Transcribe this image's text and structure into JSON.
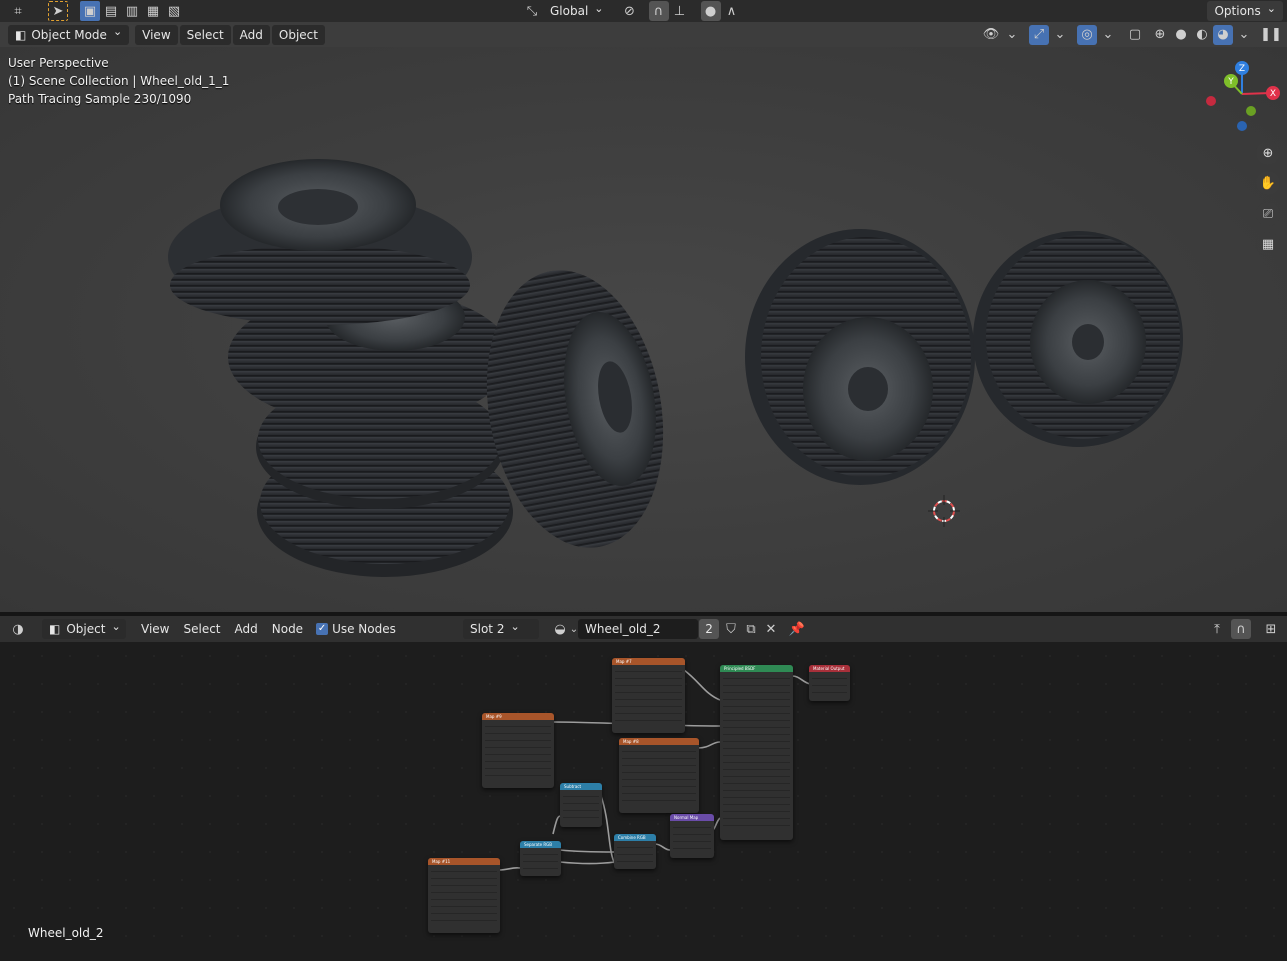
{
  "top_header": {
    "orientation": "Global",
    "options_label": "Options"
  },
  "viewport_header": {
    "mode": "Object Mode",
    "menus": [
      "View",
      "Select",
      "Add",
      "Object"
    ]
  },
  "viewport_overlay": {
    "perspective": "User Perspective",
    "collection": "(1) Scene Collection | Wheel_old_1_1",
    "render_status": "Path Tracing Sample 230/1090"
  },
  "gizmo": {
    "x_label": "X",
    "y_label": "Y",
    "z_label": "Z",
    "x_color": "#e0324a",
    "y_color": "#7fbf2a",
    "z_color": "#2f7fe0"
  },
  "node_header": {
    "type": "Object",
    "menus": [
      "View",
      "Select",
      "Add",
      "Node"
    ],
    "use_nodes_label": "Use Nodes",
    "use_nodes_checked": true,
    "slot": "Slot 2",
    "material_name": "Wheel_old_2",
    "user_count": "2"
  },
  "node_editor": {
    "material_label": "Wheel_old_2",
    "nodes": [
      {
        "title": "Map #7",
        "color": "#a8552a"
      },
      {
        "title": "Map #8",
        "color": "#a8552a"
      },
      {
        "title": "Map #9",
        "color": "#a8552a"
      },
      {
        "title": "Map #11",
        "color": "#a8552a"
      },
      {
        "title": "Principled BSDF",
        "color": "#2f8a54"
      },
      {
        "title": "Material Output",
        "color": "#a8303a"
      },
      {
        "title": "Subtract",
        "color": "#2d7fa8"
      },
      {
        "title": "Separate RGB",
        "color": "#2d7fa8"
      },
      {
        "title": "Combine RGB",
        "color": "#2d7fa8"
      },
      {
        "title": "Normal Map",
        "color": "#6a4ca8"
      }
    ]
  }
}
